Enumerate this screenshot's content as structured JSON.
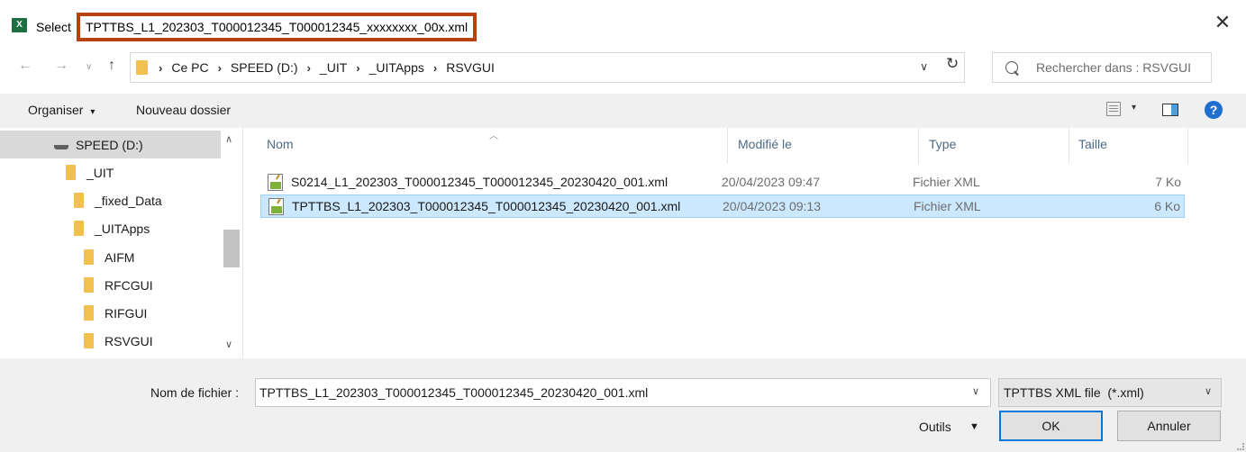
{
  "window": {
    "title_prefix": "Select",
    "title_highlighted": "TPTTBS_L1_202303_T000012345_T000012345_xxxxxxxx_00x.xml",
    "close_glyph": "✕",
    "app_icon_letter": "X"
  },
  "address": {
    "breadcrumbs": [
      "Ce PC",
      "SPEED (D:)",
      "_UIT",
      "_UITApps",
      "RSVGUI"
    ],
    "separator": "›",
    "search_placeholder": "Rechercher dans : RSVGUI"
  },
  "toolbar": {
    "organize_label": "Organiser",
    "organize_arrow": "▾",
    "new_folder_label": "Nouveau dossier",
    "help_glyph": "?"
  },
  "nav_pane": {
    "items": [
      {
        "label": "SPEED (D:)",
        "icon": "drive-icon",
        "selected": true
      },
      {
        "label": "_UIT",
        "icon": "folder-icon",
        "selected": false
      },
      {
        "label": "_fixed_Data",
        "icon": "folder-icon",
        "selected": false
      },
      {
        "label": "_UITApps",
        "icon": "folder-icon",
        "selected": false
      },
      {
        "label": "AIFM",
        "icon": "folder-icon",
        "selected": false
      },
      {
        "label": "RFCGUI",
        "icon": "folder-icon",
        "selected": false
      },
      {
        "label": "RIFGUI",
        "icon": "folder-icon",
        "selected": false
      },
      {
        "label": "RSVGUI",
        "icon": "folder-icon",
        "selected": false
      }
    ]
  },
  "file_list": {
    "columns": {
      "name": "Nom",
      "modified": "Modifié le",
      "type": "Type",
      "size": "Taille"
    },
    "rows": [
      {
        "name": "S0214_L1_202303_T000012345_T000012345_20230420_001.xml",
        "modified": "20/04/2023 09:47",
        "type": "Fichier XML",
        "size": "7 Ko",
        "selected": false
      },
      {
        "name": "TPTTBS_L1_202303_T000012345_T000012345_20230420_001.xml",
        "modified": "20/04/2023 09:13",
        "type": "Fichier XML",
        "size": "6 Ko",
        "selected": true
      }
    ]
  },
  "footer": {
    "filename_label": "Nom de fichier :",
    "filename_value": "TPTTBS_L1_202303_T000012345_T000012345_20230420_001.xml",
    "filter_value": "TPTTBS XML file  (*.xml)",
    "tools_label": "Outils",
    "ok_label": "OK",
    "cancel_label": "Annuler"
  },
  "colors": {
    "highlight_border": "#b5420f",
    "selection_bg": "#cce8ff",
    "selection_border": "#99d1ff",
    "folder": "#f2c04e",
    "primary_button_border": "#0078d7"
  }
}
